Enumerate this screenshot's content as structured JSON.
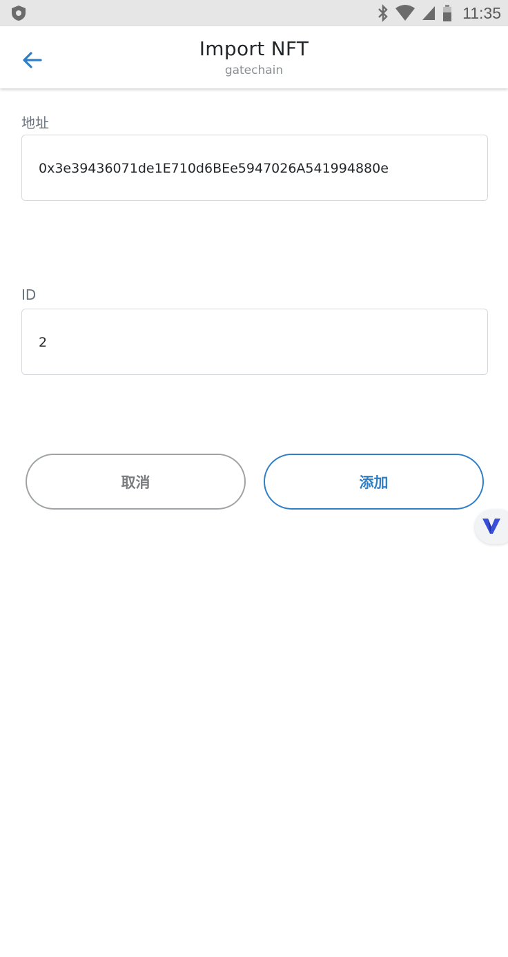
{
  "status_bar": {
    "time": "11:35",
    "icons": [
      "shield-icon",
      "bluetooth-icon",
      "wifi-icon",
      "signal-icon",
      "battery-icon"
    ]
  },
  "header": {
    "title": "Import NFT",
    "subtitle": "gatechain",
    "back_icon": "arrow-left-icon",
    "accent_color": "#2f7fc7"
  },
  "form": {
    "address_label": "地址",
    "address_value": "0x3e39436071de1E710d6BEe5947026A541994880e",
    "id_label": "ID",
    "id_value": "2"
  },
  "actions": {
    "cancel_label": "取消",
    "add_label": "添加"
  },
  "floating": {
    "icon": "v-logo-icon"
  }
}
